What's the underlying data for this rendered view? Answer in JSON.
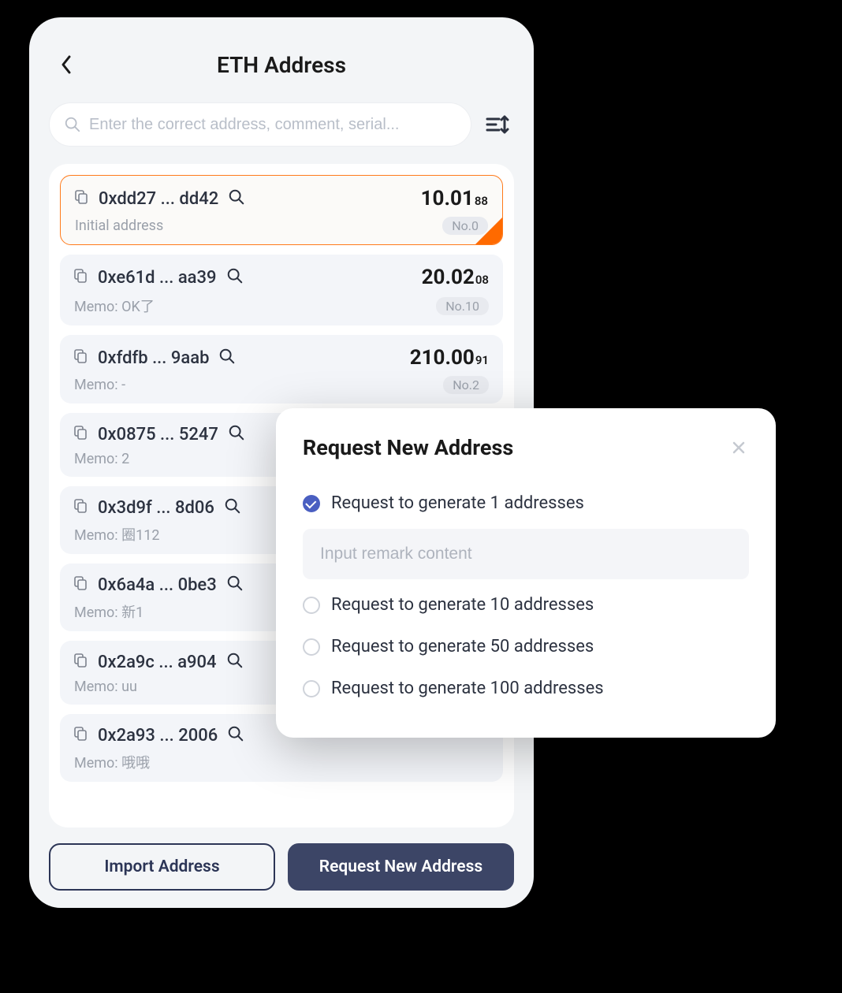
{
  "header": {
    "title": "ETH Address"
  },
  "search": {
    "placeholder": "Enter the correct address, comment, serial..."
  },
  "addresses": [
    {
      "addr": "0xdd27 ... dd42",
      "balance_main": "10.01",
      "balance_dec": "88",
      "memo": "Initial address",
      "badge": "No.0",
      "selected": true
    },
    {
      "addr": "0xe61d ... aa39",
      "balance_main": "20.02",
      "balance_dec": "08",
      "memo": "Memo: OK了",
      "badge": "No.10",
      "selected": false
    },
    {
      "addr": "0xfdfb ... 9aab",
      "balance_main": "210.00",
      "balance_dec": "91",
      "memo": "Memo: -",
      "badge": "No.2",
      "selected": false
    },
    {
      "addr": "0x0875 ... 5247",
      "balance_main": "",
      "balance_dec": "",
      "memo": "Memo: 2",
      "badge": "",
      "selected": false
    },
    {
      "addr": "0x3d9f ... 8d06",
      "balance_main": "",
      "balance_dec": "",
      "memo": "Memo: 圈112",
      "badge": "",
      "selected": false
    },
    {
      "addr": "0x6a4a ... 0be3",
      "balance_main": "",
      "balance_dec": "",
      "memo": "Memo: 新1",
      "badge": "",
      "selected": false
    },
    {
      "addr": "0x2a9c ... a904",
      "balance_main": "",
      "balance_dec": "",
      "memo": "Memo: uu",
      "badge": "",
      "selected": false
    },
    {
      "addr": "0x2a93 ... 2006",
      "balance_main": "",
      "balance_dec": "",
      "memo": "Memo: 哦哦",
      "badge": "",
      "selected": false
    }
  ],
  "buttons": {
    "import": "Import Address",
    "request": "Request New Address"
  },
  "modal": {
    "title": "Request New Address",
    "remark_placeholder": "Input remark content",
    "options": [
      {
        "label": "Request to generate 1 addresses",
        "checked": true
      },
      {
        "label": "Request to generate 10 addresses",
        "checked": false
      },
      {
        "label": "Request to generate 50 addresses",
        "checked": false
      },
      {
        "label": "Request to generate 100 addresses",
        "checked": false
      }
    ]
  }
}
